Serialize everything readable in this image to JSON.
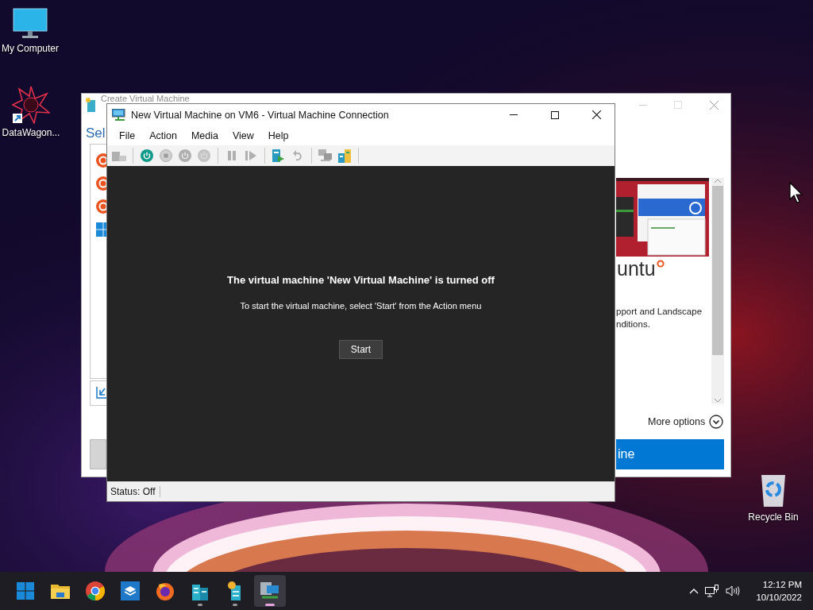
{
  "desktop_icons": [
    {
      "kind": "monitor",
      "label": "My Computer"
    },
    {
      "kind": "star",
      "label": "DataWagon..."
    },
    {
      "kind": "bin",
      "label": "Recycle Bin"
    }
  ],
  "back_window": {
    "title": "Create Virtual Machine",
    "heading": "Sel",
    "os_items": [
      {
        "kind": "ubuntu"
      },
      {
        "kind": "ubuntu"
      },
      {
        "kind": "ubuntu"
      },
      {
        "kind": "windows"
      }
    ],
    "product": "untu",
    "description": [
      "pport and Landscape",
      "nditions."
    ],
    "more_options": "More options",
    "primary_button": "ine"
  },
  "vm_window": {
    "title": "New Virtual Machine on VM6 - Virtual Machine Connection",
    "menu": [
      "File",
      "Action",
      "Media",
      "View",
      "Help"
    ],
    "toolbar": [
      {
        "kind": "keyboard",
        "disabled": true
      },
      {
        "kind": "separator"
      },
      {
        "kind": "start",
        "disabled": false
      },
      {
        "kind": "stop",
        "disabled": true
      },
      {
        "kind": "power",
        "disabled": true
      },
      {
        "kind": "save",
        "disabled": true
      },
      {
        "kind": "separator"
      },
      {
        "kind": "pause",
        "disabled": true
      },
      {
        "kind": "play",
        "disabled": true
      },
      {
        "kind": "separator"
      },
      {
        "kind": "checkpoint",
        "disabled": false
      },
      {
        "kind": "undo",
        "disabled": true
      },
      {
        "kind": "separator"
      },
      {
        "kind": "computers",
        "disabled": true
      },
      {
        "kind": "server",
        "disabled": false
      },
      {
        "kind": "separator"
      }
    ],
    "message": "The virtual machine 'New Virtual Machine' is turned off",
    "instruction": "To start the virtual machine, select 'Start' from the Action menu",
    "start_button": "Start",
    "status": "Status: Off"
  },
  "taskbar": {
    "apps": [
      {
        "kind": "start",
        "running": false,
        "selected": false
      },
      {
        "kind": "folder",
        "running": false,
        "selected": false
      },
      {
        "kind": "chrome",
        "running": false,
        "selected": false
      },
      {
        "kind": "box",
        "running": false,
        "selected": false
      },
      {
        "kind": "firefox",
        "running": false,
        "selected": false
      },
      {
        "kind": "buildings",
        "running": true,
        "selected": false
      },
      {
        "kind": "server",
        "running": true,
        "selected": false
      },
      {
        "kind": "vm",
        "running": true,
        "selected": true
      }
    ],
    "time": "12:12 PM",
    "date": "10/10/2022"
  }
}
